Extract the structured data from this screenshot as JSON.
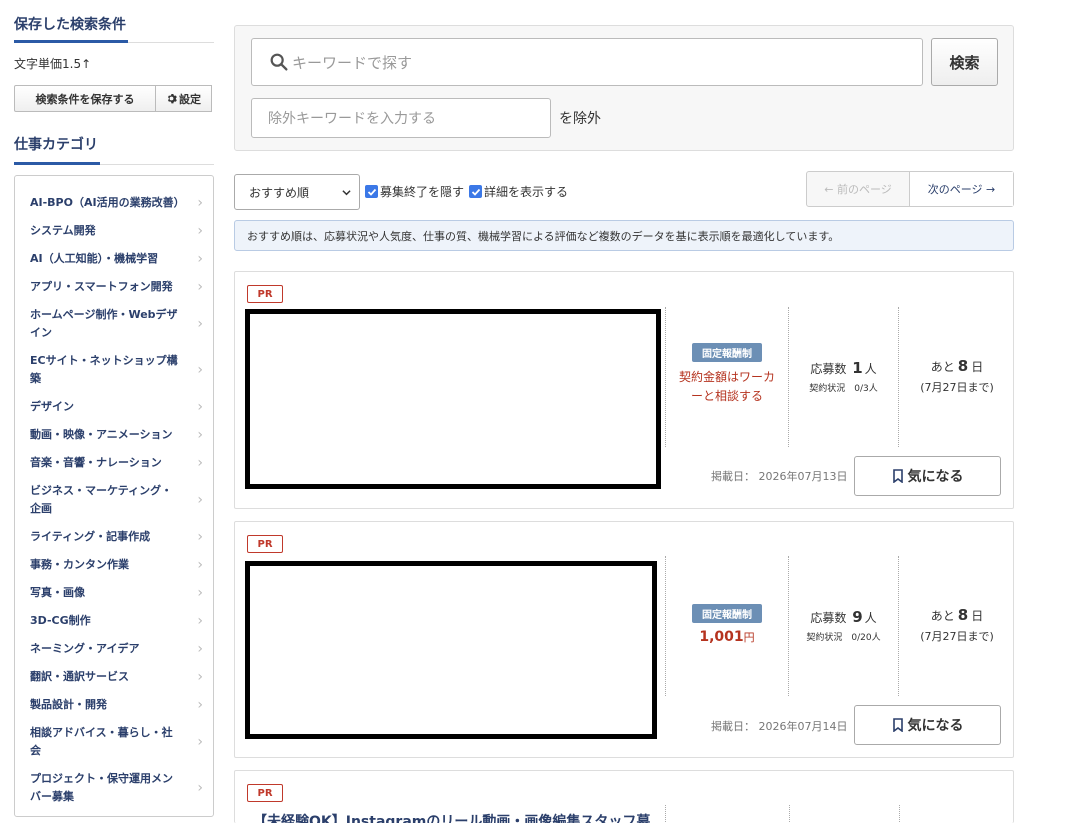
{
  "sidebar": {
    "saved_heading": "保存した検索条件",
    "saved_condition": "文字単価1.5↑",
    "save_button": "検索条件を保存する",
    "settings_button": "設定",
    "category_heading": "仕事カテゴリ",
    "categories": [
      "AI-BPO（AI活用の業務改善）",
      "システム開発",
      "AI（人工知能）・機械学習",
      "アプリ・スマートフォン開発",
      "ホームページ制作・Webデザイン",
      "ECサイト・ネットショップ構築",
      "デザイン",
      "動画・映像・アニメーション",
      "音楽・音響・ナレーション",
      "ビジネス・マーケティング・企画",
      "ライティング・記事作成",
      "事務・カンタン作業",
      "写真・画像",
      "3D-CG制作",
      "ネーミング・アイデア",
      "翻訳・通訳サービス",
      "製品設計・開発",
      "相談アドバイス・暮らし・社会",
      "プロジェクト・保守運用メンバー募集"
    ]
  },
  "search": {
    "keyword_placeholder": "キーワードで探す",
    "search_button": "検索",
    "exclude_placeholder": "除外キーワードを入力する",
    "exclude_suffix": "を除外"
  },
  "toolbar": {
    "sort_selected": "おすすめ順",
    "hide_closed": "募集終了を隠す",
    "show_details": "詳細を表示する",
    "prev_page": "← 前のページ",
    "next_page": "次のページ →"
  },
  "notice": "おすすめ順は、応募状況や人気度、仕事の質、機械学習による評価など複数のデータを基に表示順を最適化しています。",
  "jobs": [
    {
      "pr": "PR",
      "pay_type": "固定報酬制",
      "price_note_1": "契約金額はワーカ",
      "price_note_2": "ーと相談する",
      "apply_prefix": "応募数",
      "apply_count": "1",
      "apply_suffix": "人",
      "contract": "契約状況　0/3人",
      "dead_prefix": "あと",
      "dead_days": "8",
      "dead_suffix": "日",
      "dead_date": "(7月27日まで)",
      "posted": "掲載日：  2026年07月13日",
      "fav": "気になる"
    },
    {
      "pr": "PR",
      "pay_type": "固定報酬制",
      "price": "1,001",
      "price_unit": "円",
      "apply_prefix": "応募数",
      "apply_count": "9",
      "apply_suffix": "人",
      "contract": "契約状況　0/20人",
      "dead_prefix": "あと",
      "dead_days": "8",
      "dead_suffix": "日",
      "dead_date": "(7月27日まで)",
      "posted": "掲載日：  2026年07月14日",
      "fav": "気になる"
    },
    {
      "pr": "PR",
      "title": "【未経験OK】Instagramのリール動画・画像編集スタッフ募"
    }
  ],
  "colors": {
    "navy": "#2b3f6b",
    "accent_blue": "#2b5aa6",
    "price_red": "#b5331f",
    "badge_blue": "#6c8fb5"
  }
}
